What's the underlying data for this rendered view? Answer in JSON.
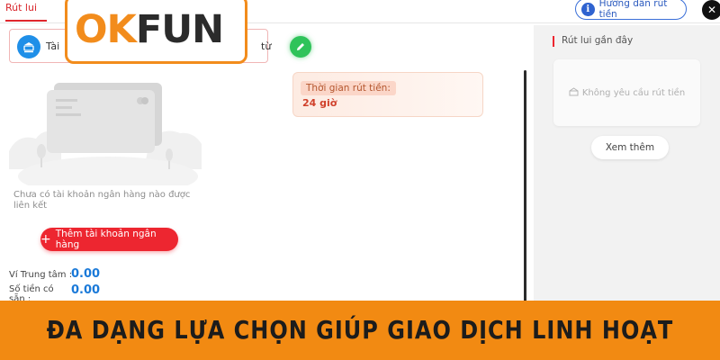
{
  "header": {
    "tab_withdraw": "Rút lui",
    "guide_button": "Hướng dẫn rút tiền",
    "close_symbol": "✕"
  },
  "logo": {
    "part1": "OK",
    "part2": "FUN",
    "colors": {
      "ok": "#f28c1c",
      "fun": "#2b2b2b"
    }
  },
  "method": {
    "bank_label": "Tài",
    "other_label": "từ",
    "icons": [
      "bank-card-icon",
      "edit-pencil-icon"
    ]
  },
  "bank": {
    "empty_text": "Chưa có tài khoản ngân hàng nào được liên kết",
    "add_button": "Thêm tài khoản ngân hàng"
  },
  "balances": {
    "wallet_label": "Ví Trung tâm :",
    "wallet_value": "0.00",
    "available_label": "Số tiền có sẵn :",
    "available_value": "0.00"
  },
  "withdraw_time": {
    "label": "Thời gian rút tiền:",
    "value": "24 giờ"
  },
  "recent": {
    "title": "Rút lui gần đây",
    "empty_text": "Không yêu cầu rút tiền",
    "see_more": "Xem thêm"
  },
  "banner": {
    "text": "ĐA DẠNG LỰA CHỌN GIÚP GIAO DỊCH LINH HOẠT"
  },
  "colors": {
    "accent_red": "#ed2630",
    "banner_orange": "#f28a12",
    "value_blue": "#1a79d8"
  }
}
